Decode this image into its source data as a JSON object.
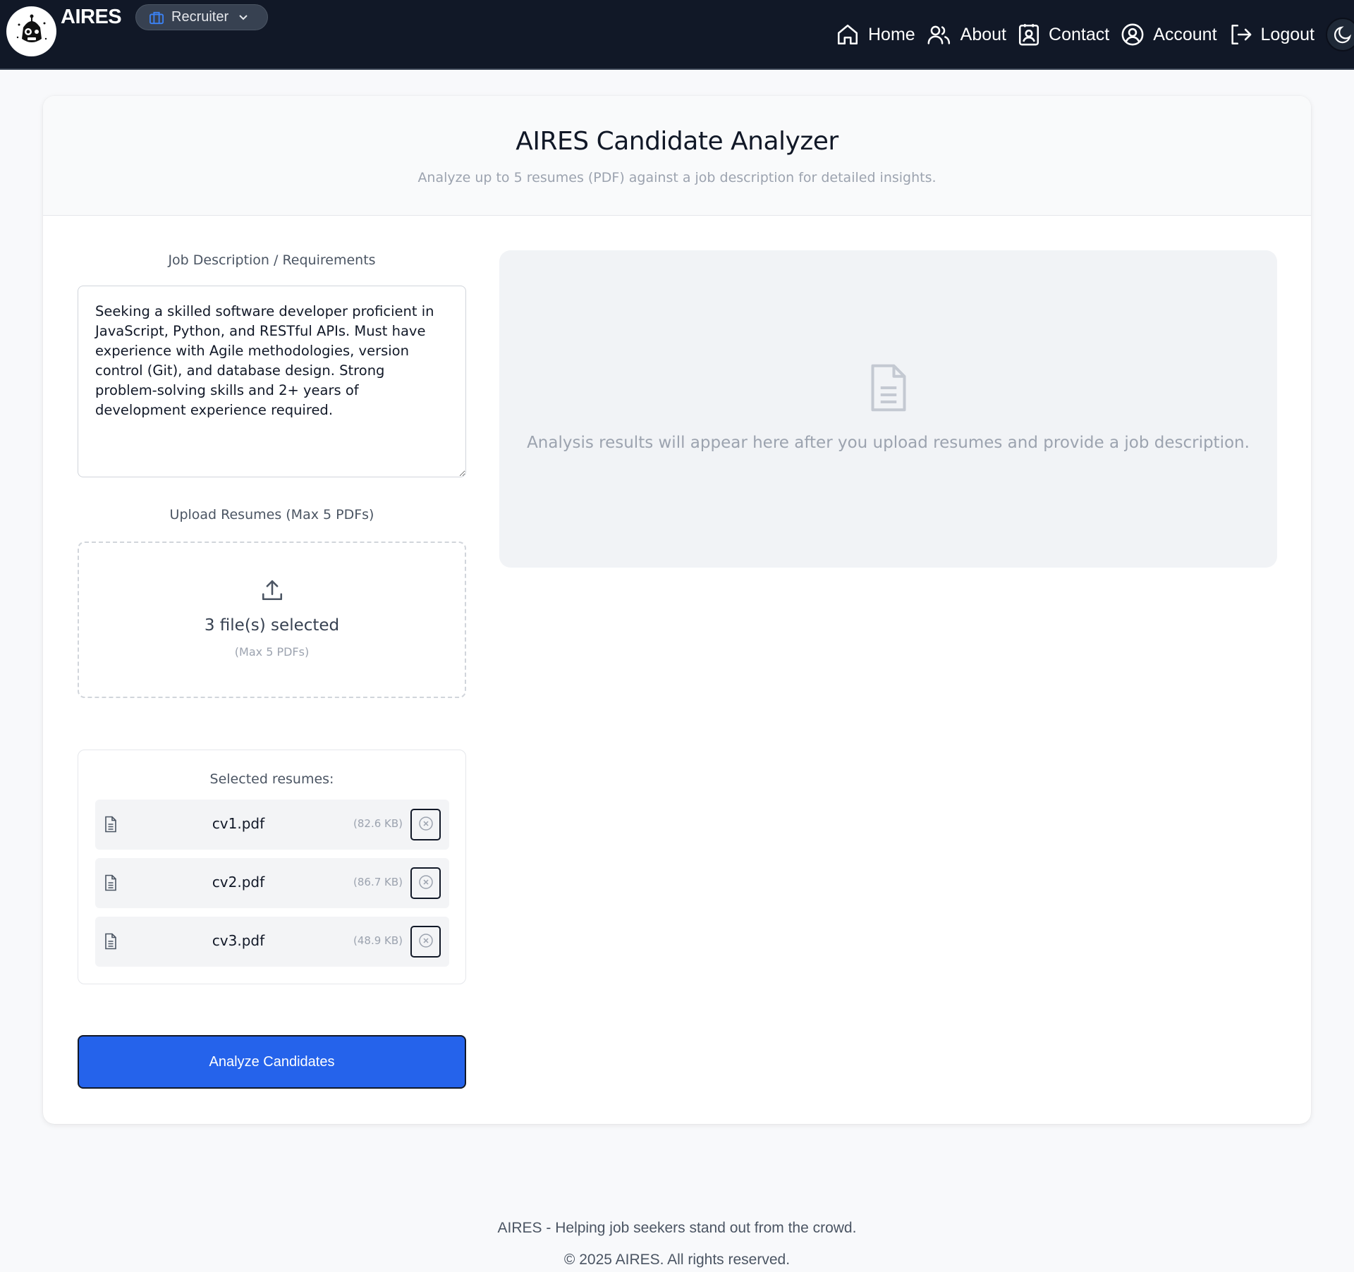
{
  "navbar": {
    "brand": "AIRES",
    "role": {
      "selected": "Recruiter"
    },
    "links": {
      "home": "Home",
      "about": "About",
      "contact": "Contact",
      "account": "Account",
      "logout": "Logout"
    }
  },
  "header": {
    "title": "AIRES Candidate Analyzer",
    "subtitle": "Analyze up to 5 resumes (PDF) against a job description for detailed insights."
  },
  "job_description": {
    "label": "Job Description / Requirements",
    "value": "Seeking a skilled software developer proficient in JavaScript, Python, and RESTful APIs. Must have experience with Agile methodologies, version control (Git), and database design. Strong problem-solving skills and 2+ years of development experience required."
  },
  "upload": {
    "label": "Upload Resumes (Max 5 PDFs)",
    "status": "3 file(s) selected",
    "hint": "(Max 5 PDFs)"
  },
  "selected": {
    "title": "Selected resumes:",
    "files": [
      {
        "name": "cv1.pdf",
        "size": "(82.6 KB)"
      },
      {
        "name": "cv2.pdf",
        "size": "(86.7 KB)"
      },
      {
        "name": "cv3.pdf",
        "size": "(48.9 KB)"
      }
    ]
  },
  "actions": {
    "analyze": "Analyze Candidates"
  },
  "results": {
    "placeholder": "Analysis results will appear here after you upload resumes and provide a job description."
  },
  "footer": {
    "tagline": "AIRES - Helping job seekers stand out from the crowd.",
    "copyright": "© 2025 AIRES. All rights reserved."
  },
  "colors": {
    "navbar_bg": "#111827",
    "accent": "#2563eb",
    "role_icon": "#3b82f6"
  }
}
